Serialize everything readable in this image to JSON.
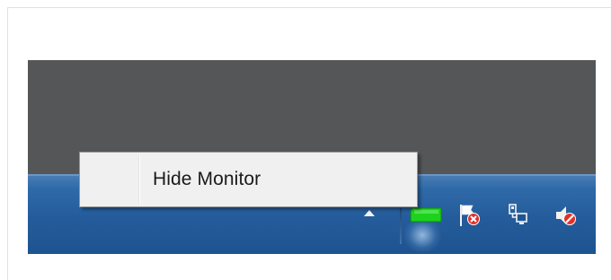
{
  "context_menu": {
    "items": [
      {
        "label": "Hide Monitor"
      }
    ]
  },
  "tray": {
    "icons": [
      {
        "name": "show-hidden-icons-arrow"
      },
      {
        "name": "monitor-status-icon",
        "color": "#1fd11f"
      },
      {
        "name": "action-center-flag-icon"
      },
      {
        "name": "network-disconnected-icon"
      },
      {
        "name": "volume-muted-icon"
      }
    ]
  },
  "colors": {
    "desktop": "#545658",
    "taskbar": "#245c9b",
    "menu_background": "#f0f0f0",
    "monitor_icon_green": "#1fd11f",
    "error_red": "#e0312b"
  }
}
